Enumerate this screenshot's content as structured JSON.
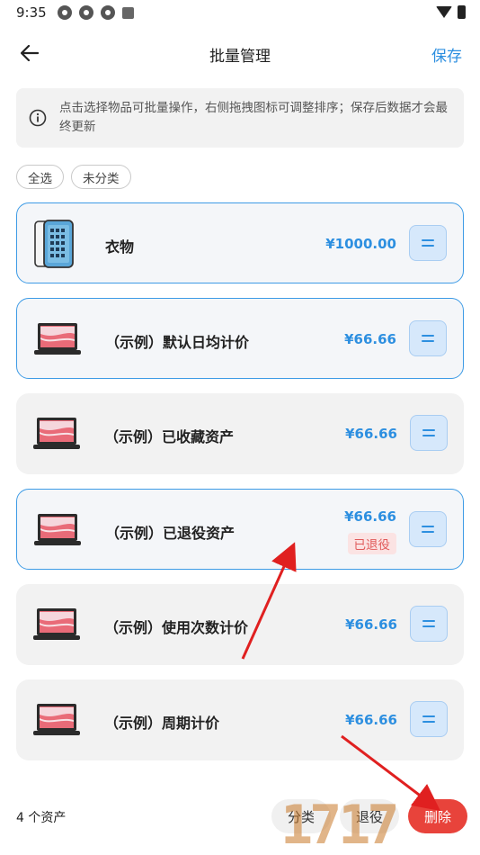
{
  "status_bar": {
    "time": "9:35"
  },
  "header": {
    "title": "批量管理",
    "save_label": "保存"
  },
  "info": {
    "text": "点击选择物品可批量操作，右侧拖拽图标可调整排序；保存后数据才会最终更新"
  },
  "chips": [
    {
      "label": "全选"
    },
    {
      "label": "未分类"
    }
  ],
  "items": [
    {
      "name": "衣物",
      "price": "¥1000.00",
      "selected": true,
      "thumb": "phone"
    },
    {
      "name": "（示例）默认日均计价",
      "price": "¥66.66",
      "selected": true,
      "thumb": "laptop"
    },
    {
      "name": "（示例）已收藏资产",
      "price": "¥66.66",
      "selected": false,
      "thumb": "laptop"
    },
    {
      "name": "（示例）已退役资产",
      "price": "¥66.66",
      "tag": "已退役",
      "selected": true,
      "thumb": "laptop"
    },
    {
      "name": "（示例）使用次数计价",
      "price": "¥66.66",
      "selected": false,
      "thumb": "laptop"
    },
    {
      "name": "（示例）周期计价",
      "price": "¥66.66",
      "selected": false,
      "thumb": "laptop"
    }
  ],
  "bottom": {
    "count_label": "4 个资产",
    "categorize_label": "分类",
    "retire_label": "退役",
    "delete_label": "删除"
  },
  "watermark": {
    "text": "1717"
  },
  "colors": {
    "accent": "#2d8fe0",
    "danger": "#e8433b",
    "selected_border": "#3d9be6"
  }
}
